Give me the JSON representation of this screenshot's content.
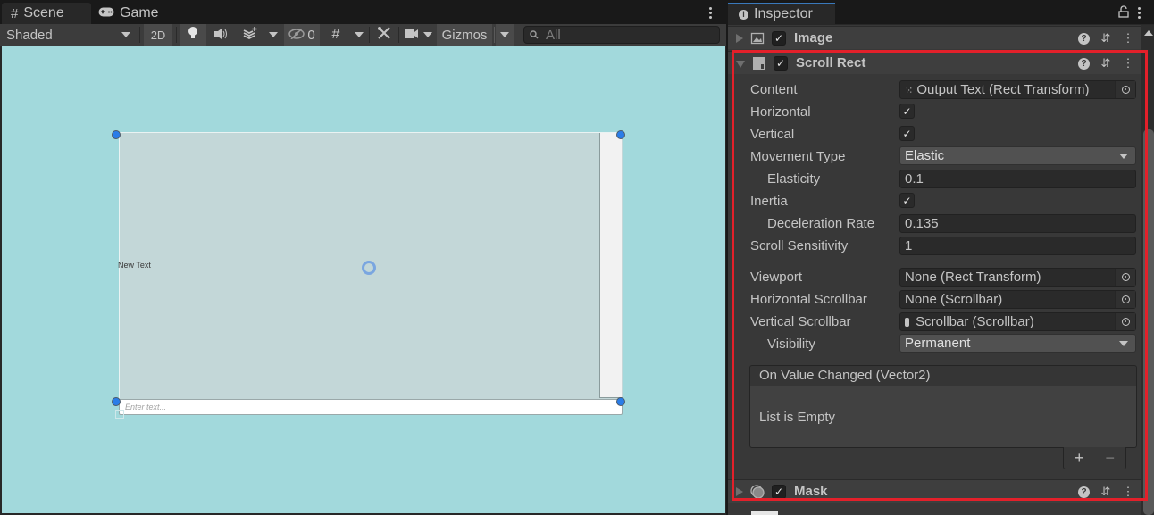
{
  "scene_window": {
    "tabs": [
      {
        "label": "Scene",
        "icon": "grid-hash-icon",
        "active": true
      },
      {
        "label": "Game",
        "icon": "gamepad-icon",
        "active": false
      }
    ],
    "toolbar": {
      "draw_mode": "Shaded",
      "mode_2d_label": "2D",
      "hidden_count": "0",
      "gizmos_label": "Gizmos",
      "search_placeholder": "All"
    },
    "viewport": {
      "background_color": "#a2d9dc",
      "text_object_label": "New Text",
      "input_placeholder": "Enter text..."
    }
  },
  "inspector": {
    "tab_label": "Inspector",
    "components": [
      {
        "name": "Image",
        "enabled": true,
        "expanded": false
      },
      {
        "name": "Scroll Rect",
        "enabled": true,
        "expanded": true
      },
      {
        "name": "Mask",
        "enabled": true,
        "expanded": false
      }
    ],
    "scroll_rect": {
      "content": {
        "label": "Content",
        "value": "Output Text (Rect Transform)"
      },
      "horizontal": {
        "label": "Horizontal",
        "checked": true
      },
      "vertical": {
        "label": "Vertical",
        "checked": true
      },
      "movement_type": {
        "label": "Movement Type",
        "value": "Elastic"
      },
      "elasticity": {
        "label": "Elasticity",
        "value": "0.1"
      },
      "inertia": {
        "label": "Inertia",
        "checked": true
      },
      "deceleration_rate": {
        "label": "Deceleration Rate",
        "value": "0.135"
      },
      "scroll_sensitivity": {
        "label": "Scroll Sensitivity",
        "value": "1"
      },
      "viewport": {
        "label": "Viewport",
        "value": "None (Rect Transform)"
      },
      "horizontal_scrollbar": {
        "label": "Horizontal Scrollbar",
        "value": "None (Scrollbar)"
      },
      "vertical_scrollbar": {
        "label": "Vertical Scrollbar",
        "value": "Scrollbar (Scrollbar)"
      },
      "visibility": {
        "label": "Visibility",
        "value": "Permanent"
      },
      "on_value_changed": {
        "label": "On Value Changed (Vector2)",
        "empty_text": "List is Empty",
        "add_label": "+",
        "remove_label": "−"
      }
    },
    "highlight_color": "#e3202a",
    "check_glyph": "✓"
  }
}
